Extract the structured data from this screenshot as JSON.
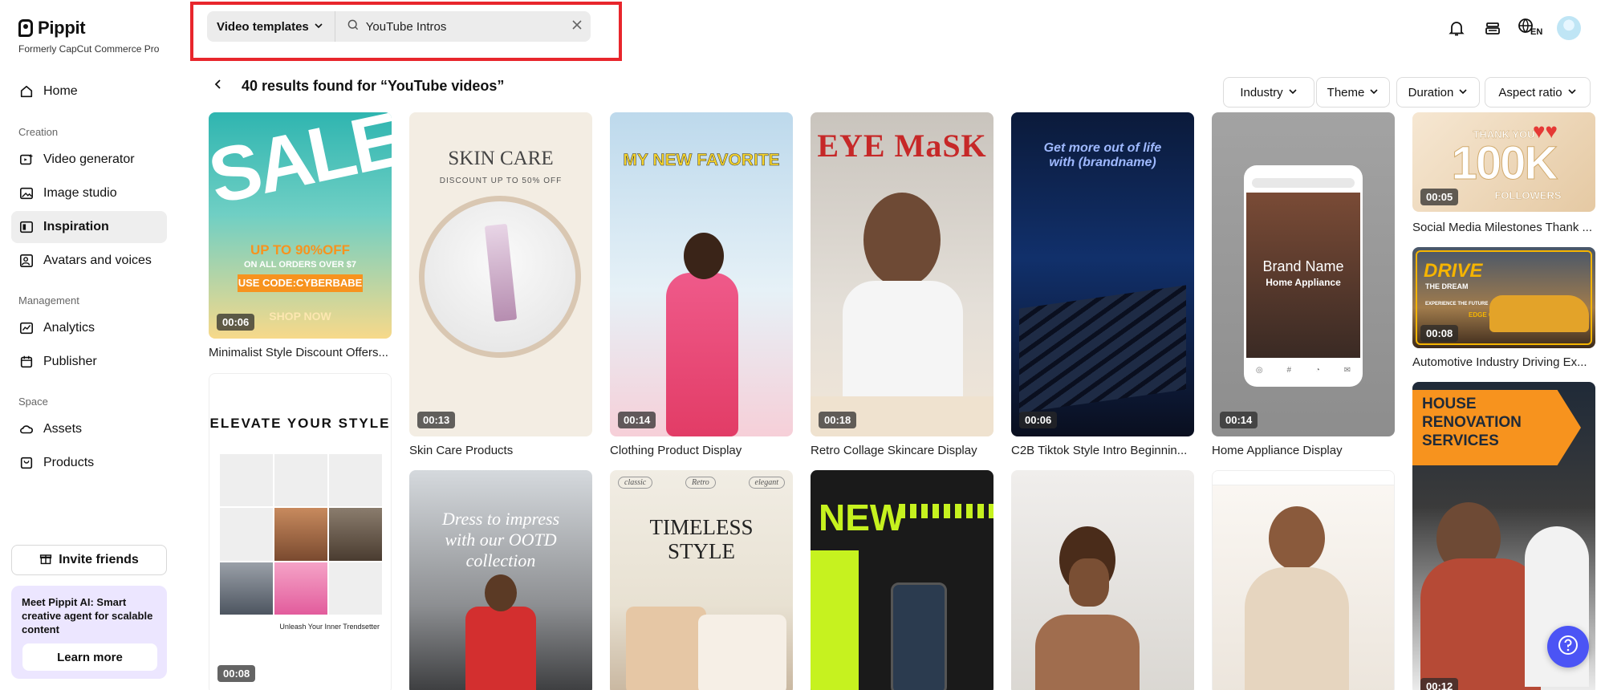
{
  "brand": {
    "name": "Pippit",
    "subtitle": "Formerly CapCut Commerce Pro"
  },
  "sidebar": {
    "home": "Home",
    "creation_label": "Creation",
    "creation": [
      "Video generator",
      "Image studio",
      "Inspiration",
      "Avatars and voices"
    ],
    "management_label": "Management",
    "management": [
      "Analytics",
      "Publisher"
    ],
    "space_label": "Space",
    "space": [
      "Assets",
      "Products"
    ],
    "active": "Inspiration",
    "invite": "Invite friends",
    "promo_text": "Meet Pippit AI: Smart creative agent for scalable content",
    "promo_button": "Learn more"
  },
  "search": {
    "type": "Video templates",
    "query": "YouTube Intros"
  },
  "header": {
    "language": "EN"
  },
  "results": {
    "title": "40 results found for “YouTube videos”",
    "filters": [
      "Industry",
      "Theme",
      "Duration",
      "Aspect ratio"
    ]
  },
  "cards": [
    {
      "title": "Minimalist Style Discount Offers...",
      "duration": "00:06",
      "overlay": [
        "SALE",
        "UP TO 90%OFF",
        "ON ALL ORDERS OVER $7",
        "USE CODE:CYBERBABE",
        "SHOP NOW"
      ]
    },
    {
      "title": "Skin Care Products",
      "duration": "00:13",
      "overlay": [
        "SKIN CARE",
        "DISCOUNT UP TO 50% OFF"
      ]
    },
    {
      "title": "Clothing Product Display",
      "duration": "00:14",
      "overlay": [
        "MY NEW FAVORITE"
      ]
    },
    {
      "title": "Retro Collage Skincare Display",
      "duration": "00:18",
      "overlay": [
        "EYE MaSK"
      ]
    },
    {
      "title": "C2B Tiktok Style Intro Beginnin...",
      "duration": "00:06",
      "overlay": [
        "Get more out of life with (brandname)"
      ]
    },
    {
      "title": "Home Appliance Display",
      "duration": "00:14",
      "overlay": [
        "Brand Name",
        "Home Appliance"
      ]
    },
    {
      "title": "Social Media Milestones Thank ...",
      "duration": "00:05",
      "overlay": [
        "THANK YOU",
        "100K",
        "FOLLOWERS"
      ]
    },
    {
      "title": "Automotive Industry Driving Ex...",
      "duration": "00:08",
      "overlay": [
        "DRIVE",
        "THE DREAM",
        "EXPERIENCE THE FUTURE",
        "EDGE CARS"
      ]
    },
    {
      "title": "",
      "duration": "00:08",
      "overlay": [
        "ELEVATE YOUR STYLE",
        "Unleash Your Inner Trendsetter"
      ]
    },
    {
      "title": "",
      "duration": "",
      "overlay": [
        "Dress to impress with our OOTD collection"
      ]
    },
    {
      "title": "",
      "duration": "",
      "overlay": [
        "classic",
        "Retro",
        "elegant",
        "TIMELESS STYLE"
      ]
    },
    {
      "title": "",
      "duration": "",
      "overlay": [
        "NEW"
      ]
    },
    {
      "title": "",
      "duration": "",
      "overlay": []
    },
    {
      "title": "",
      "duration": "",
      "overlay": []
    },
    {
      "title": "",
      "duration": "00:12",
      "overlay": [
        "HOUSE RENOVATION SERVICES"
      ]
    }
  ],
  "colors": {
    "accent_red": "#e8262c",
    "help_button": "#4b54f5",
    "active_nav": "#eeeeee",
    "promo_bg": "#ece6ff"
  }
}
